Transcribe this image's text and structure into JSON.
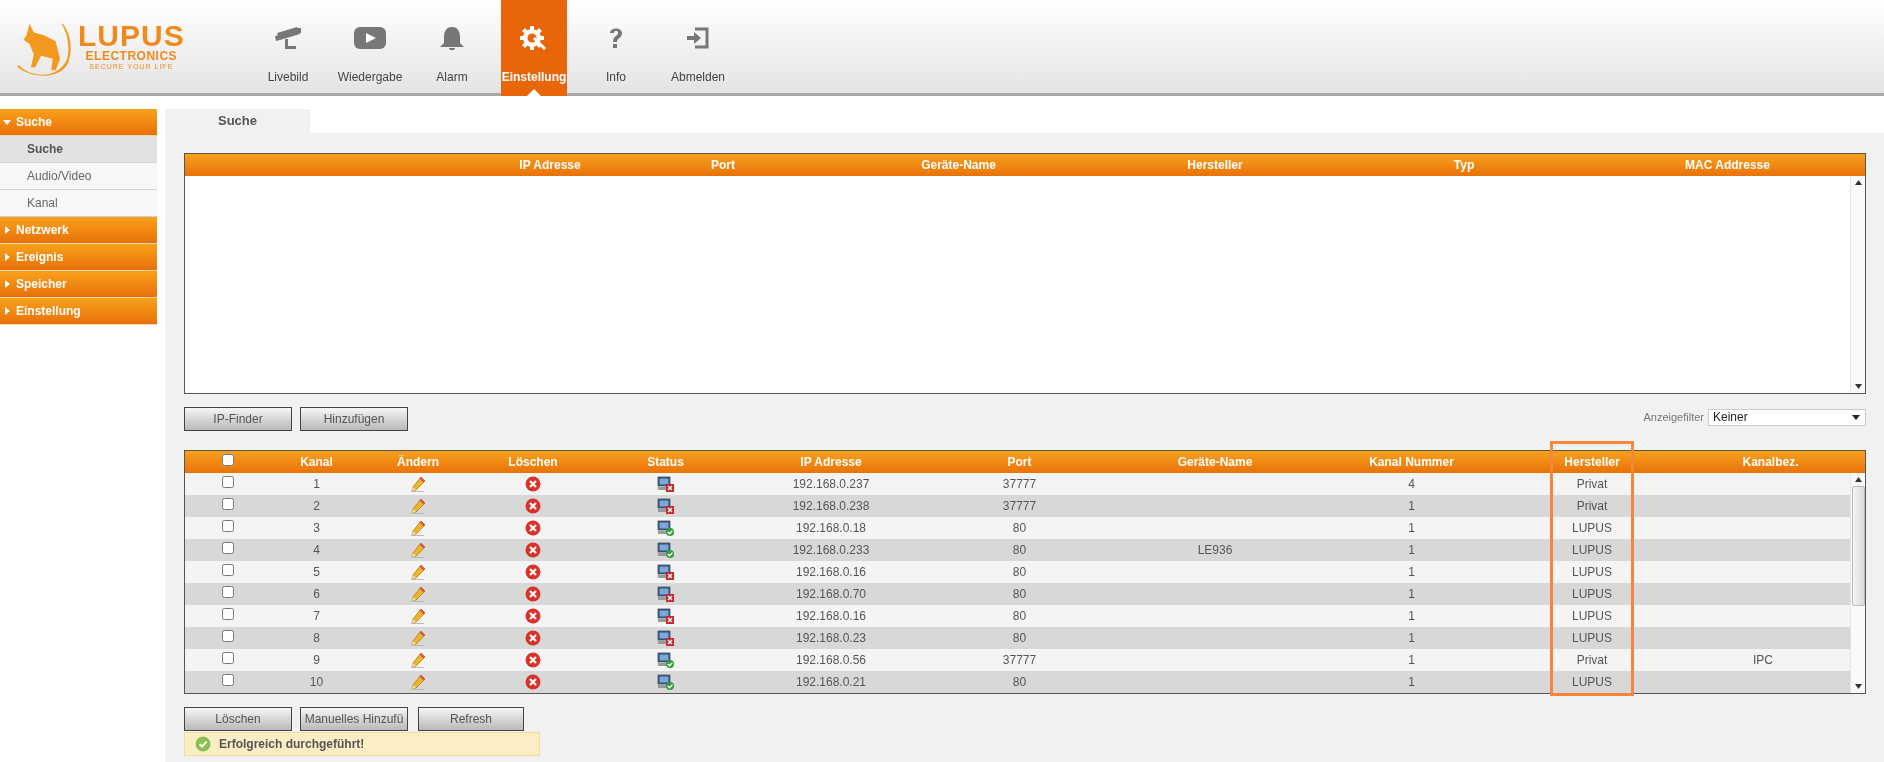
{
  "logo": {
    "name": "LUPUS",
    "subtitle": "ELECTRONICS",
    "tagline": "SECURE YOUR LIFE"
  },
  "nav": [
    {
      "label": "Livebild",
      "selected": false
    },
    {
      "label": "Wiedergabe",
      "selected": false
    },
    {
      "label": "Alarm",
      "selected": false
    },
    {
      "label": "Einstellung",
      "selected": true
    },
    {
      "label": "Info",
      "selected": false
    },
    {
      "label": "Abmelden",
      "selected": false
    }
  ],
  "sidebar": [
    {
      "label": "Suche",
      "expanded": true,
      "children": [
        {
          "label": "Suche",
          "selected": true
        },
        {
          "label": "Audio/Video",
          "selected": false
        },
        {
          "label": "Kanal",
          "selected": false
        }
      ]
    },
    {
      "label": "Netzwerk",
      "expanded": false
    },
    {
      "label": "Ereignis",
      "expanded": false
    },
    {
      "label": "Speicher",
      "expanded": false
    },
    {
      "label": "Einstellung",
      "expanded": false
    }
  ],
  "tabs": [
    {
      "label": "Suche",
      "selected": true
    }
  ],
  "search_table": {
    "columns": [
      "IP Adresse",
      "Port",
      "Geräte-Name",
      "Hersteller",
      "Typ",
      "MAC Addresse"
    ]
  },
  "search_buttons": [
    "IP-Finder",
    "Hinzufügen"
  ],
  "filter": {
    "label": "Anzeigefilter",
    "value": "Keiner"
  },
  "device_table": {
    "select_all_checked": false,
    "columns": [
      {
        "label": "Kanal",
        "highlighted": false
      },
      {
        "label": "Ändern",
        "highlighted": false
      },
      {
        "label": "Löschen",
        "highlighted": false
      },
      {
        "label": "Status",
        "highlighted": false
      },
      {
        "label": "IP Adresse",
        "highlighted": false
      },
      {
        "label": "Port",
        "highlighted": false
      },
      {
        "label": "Geräte-Name",
        "highlighted": false
      },
      {
        "label": "Kanal Nummer",
        "highlighted": false
      },
      {
        "label": "Hersteller",
        "highlighted": true
      },
      {
        "label": "Kanalbez.",
        "highlighted": false
      }
    ],
    "rows": [
      {
        "checked": false,
        "kanal": "1",
        "online": false,
        "ip": "192.168.0.237",
        "port": "37777",
        "kanal_nummer": "4",
        "hersteller": "Privat"
      },
      {
        "checked": false,
        "kanal": "2",
        "online": false,
        "ip": "192.168.0.238",
        "port": "37777",
        "kanal_nummer": "1",
        "hersteller": "Privat"
      },
      {
        "checked": false,
        "kanal": "3",
        "online": true,
        "ip": "192.168.0.18",
        "port": "80",
        "kanal_nummer": "1",
        "hersteller": "LUPUS"
      },
      {
        "checked": false,
        "kanal": "4",
        "online": true,
        "ip": "192.168.0.233",
        "port": "80",
        "name": "LE936",
        "kanal_nummer": "1",
        "hersteller": "LUPUS"
      },
      {
        "checked": false,
        "kanal": "5",
        "online": false,
        "ip": "192.168.0.16",
        "port": "80",
        "kanal_nummer": "1",
        "hersteller": "LUPUS"
      },
      {
        "checked": false,
        "kanal": "6",
        "online": false,
        "ip": "192.168.0.70",
        "port": "80",
        "kanal_nummer": "1",
        "hersteller": "LUPUS"
      },
      {
        "checked": false,
        "kanal": "7",
        "online": false,
        "ip": "192.168.0.16",
        "port": "80",
        "kanal_nummer": "1",
        "hersteller": "LUPUS"
      },
      {
        "checked": false,
        "kanal": "8",
        "online": false,
        "ip": "192.168.0.23",
        "port": "80",
        "kanal_nummer": "1",
        "hersteller": "LUPUS"
      },
      {
        "checked": false,
        "kanal": "9",
        "online": true,
        "ip": "192.168.0.56",
        "port": "37777",
        "kanal_nummer": "1",
        "hersteller": "Privat",
        "kanalbez": "IPC"
      },
      {
        "checked": false,
        "kanal": "10",
        "online": true,
        "ip": "192.168.0.21",
        "port": "80",
        "kanal_nummer": "1",
        "hersteller": "LUPUS"
      }
    ]
  },
  "device_buttons": [
    "Löschen",
    "Manuelles Hinzufü",
    "Refresh"
  ],
  "message": {
    "kind": "success",
    "text": "Erfolgreich durchgeführt!"
  }
}
